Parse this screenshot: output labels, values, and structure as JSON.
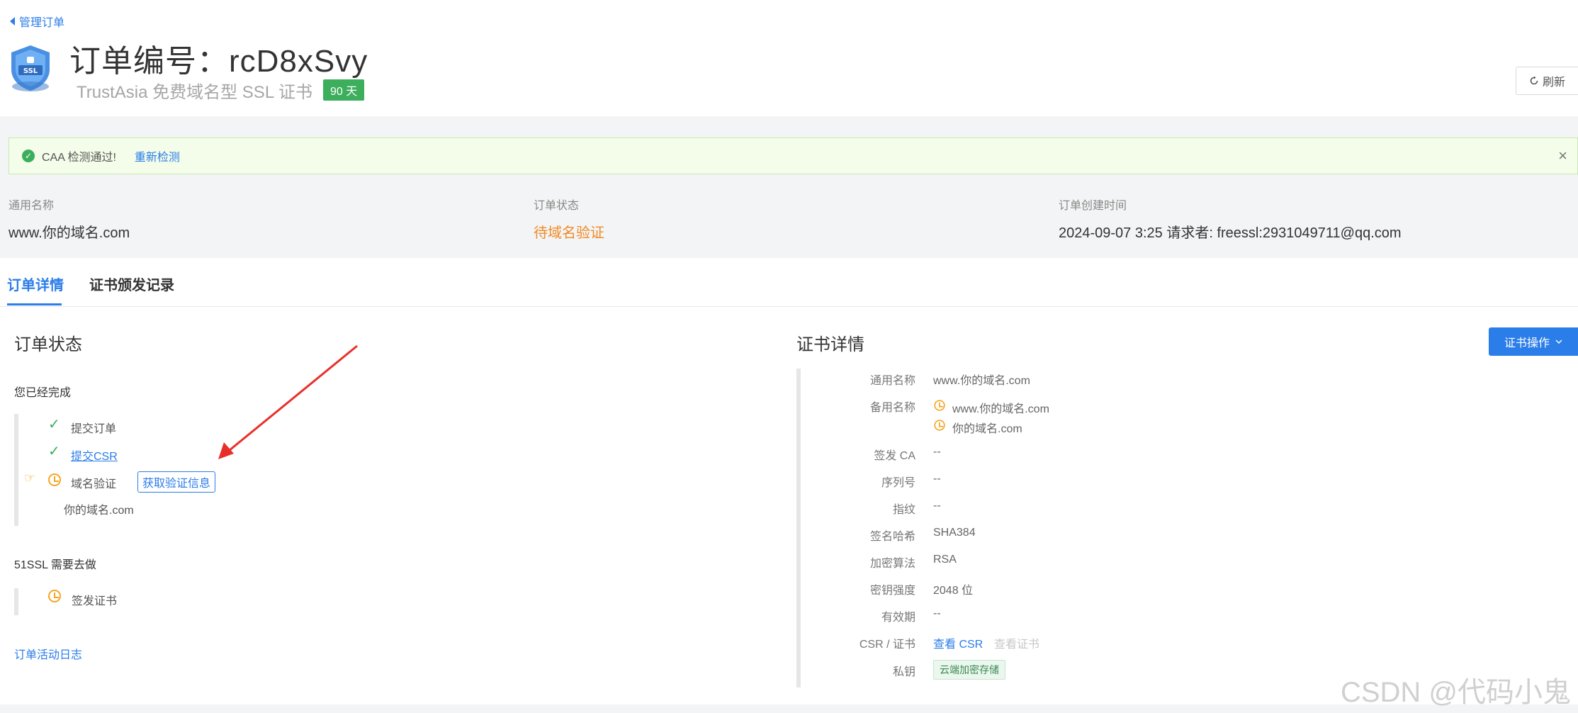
{
  "header": {
    "back_label": "管理订单",
    "order_title": "订单编号：rcD8xSvy",
    "product_name": "TrustAsia 免费域名型 SSL 证书",
    "days_badge": "90 天",
    "refresh_label": "刷新"
  },
  "alert": {
    "message": "CAA 检测通过!",
    "recheck_label": "重新检测"
  },
  "info": {
    "common_name_label": "通用名称",
    "common_name_value": "www.你的域名.com",
    "status_label": "订单状态",
    "status_value": "待域名验证",
    "created_label": "订单创建时间",
    "created_value": "2024-09-07 3:25 请求者: freessl:2931049711@qq.com"
  },
  "tabs": [
    {
      "label": "订单详情",
      "active": true
    },
    {
      "label": "证书颁发记录",
      "active": false
    }
  ],
  "order_status": {
    "title": "订单状态",
    "completed_heading": "您已经完成",
    "steps": [
      {
        "label": "提交订单",
        "state": "done"
      },
      {
        "label": "提交CSR",
        "state": "done",
        "link": true
      },
      {
        "label": "域名验证",
        "state": "pending",
        "button": "获取验证信息",
        "sub": "你的域名.com"
      }
    ],
    "todo_heading": "51SSL 需要去做",
    "todo_steps": [
      {
        "label": "签发证书",
        "state": "pending"
      }
    ],
    "activity_log_label": "订单活动日志"
  },
  "cert_details": {
    "title": "证书详情",
    "op_button": "证书操作",
    "rows": [
      {
        "label": "通用名称",
        "value": "www.你的域名.com"
      },
      {
        "label": "备用名称",
        "values": [
          "www.你的域名.com",
          "你的域名.com"
        ]
      },
      {
        "label": "签发 CA",
        "value": "--"
      },
      {
        "label": "序列号",
        "value": "--"
      },
      {
        "label": "指纹",
        "value": "--"
      },
      {
        "label": "签名哈希",
        "value": "SHA384"
      },
      {
        "label": "加密算法",
        "value": "RSA"
      },
      {
        "label": "密钥强度",
        "value": "2048 位"
      },
      {
        "label": "有效期",
        "value": "--"
      },
      {
        "label": "CSR / 证书",
        "link": "查看 CSR",
        "disabled": "查看证书"
      },
      {
        "label": "私钥",
        "tag": "云端加密存储"
      }
    ]
  },
  "watermark": "CSDN @代码小鬼",
  "colors": {
    "primary": "#2b7de9",
    "success": "#3cae5c",
    "warning": "#f5a623",
    "status_orange": "#f08a24"
  }
}
